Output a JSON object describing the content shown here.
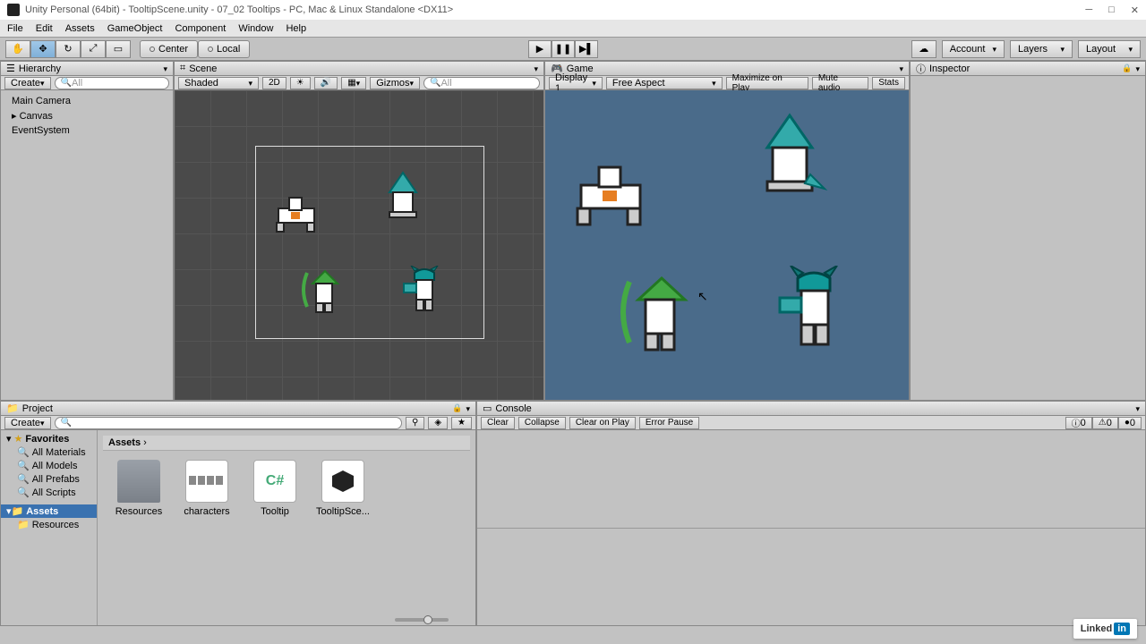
{
  "window": {
    "title": "Unity Personal (64bit) - TooltipScene.unity - 07_02 Tooltips - PC, Mac & Linux Standalone <DX11>"
  },
  "menu": [
    "File",
    "Edit",
    "Assets",
    "GameObject",
    "Component",
    "Window",
    "Help"
  ],
  "toolbar": {
    "center": "Center",
    "local": "Local",
    "account": "Account",
    "layers": "Layers",
    "layout": "Layout"
  },
  "hierarchy": {
    "title": "Hierarchy",
    "create": "Create",
    "search_placeholder": "All",
    "items": [
      "Main Camera",
      "Canvas",
      "EventSystem"
    ]
  },
  "scene": {
    "title": "Scene",
    "shading": "Shaded",
    "mode2d": "2D",
    "gizmos": "Gizmos",
    "search_placeholder": "All"
  },
  "game": {
    "title": "Game",
    "display": "Display 1",
    "aspect": "Free Aspect",
    "maximize": "Maximize on Play",
    "mute": "Mute audio",
    "stats": "Stats"
  },
  "inspector": {
    "title": "Inspector"
  },
  "project": {
    "title": "Project",
    "create": "Create",
    "favorites": "Favorites",
    "fav_items": [
      "All Materials",
      "All Models",
      "All Prefabs",
      "All Scripts"
    ],
    "assets_root": "Assets",
    "folders": [
      "Resources"
    ],
    "breadcrumb": "Assets",
    "grid_items": [
      "Resources",
      "characters",
      "Tooltip",
      "TooltipSce..."
    ]
  },
  "console": {
    "title": "Console",
    "clear": "Clear",
    "collapse": "Collapse",
    "clear_on_play": "Clear on Play",
    "error_pause": "Error Pause",
    "counts": [
      "0",
      "0",
      "0"
    ]
  },
  "linkedin": {
    "linked": "Linked",
    "in": "in"
  }
}
